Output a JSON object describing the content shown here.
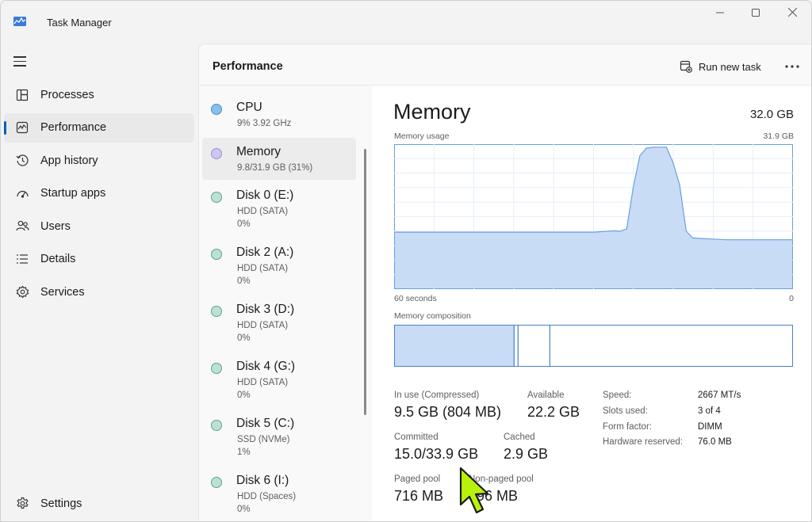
{
  "window": {
    "title": "Task Manager"
  },
  "icons": {
    "app": "task-manager-icon",
    "minimize": "minimize-icon",
    "maximize": "maximize-icon",
    "close": "close-icon",
    "menu": "hamburger-menu-icon",
    "run_task": "run-new-task-icon",
    "more": "more-options-icon"
  },
  "nav": {
    "items": [
      {
        "label": "Processes",
        "icon": "processes-icon",
        "active": false
      },
      {
        "label": "Performance",
        "icon": "performance-icon",
        "active": true
      },
      {
        "label": "App history",
        "icon": "app-history-icon",
        "active": false
      },
      {
        "label": "Startup apps",
        "icon": "startup-apps-icon",
        "active": false
      },
      {
        "label": "Users",
        "icon": "users-icon",
        "active": false
      },
      {
        "label": "Details",
        "icon": "details-icon",
        "active": false
      },
      {
        "label": "Services",
        "icon": "services-icon",
        "active": false
      }
    ],
    "settings": "Settings"
  },
  "header": {
    "title": "Performance",
    "run_task": "Run new task"
  },
  "devices": [
    {
      "name": "CPU",
      "line1": "9%  3.92 GHz",
      "line2": ""
    },
    {
      "name": "Memory",
      "line1": "9.8/31.9 GB (31%)",
      "line2": ""
    },
    {
      "name": "Disk 0 (E:)",
      "line1": "HDD (SATA)",
      "line2": "0%"
    },
    {
      "name": "Disk 2 (A:)",
      "line1": "HDD (SATA)",
      "line2": "0%"
    },
    {
      "name": "Disk 3 (D:)",
      "line1": "HDD (SATA)",
      "line2": "0%"
    },
    {
      "name": "Disk 4 (G:)",
      "line1": "HDD (SATA)",
      "line2": "0%"
    },
    {
      "name": "Disk 5 (C:)",
      "line1": "SSD (NVMe)",
      "line2": "1%"
    },
    {
      "name": "Disk 6 (I:)",
      "line1": "HDD (Spaces)",
      "line2": "0%"
    }
  ],
  "colors": {
    "accent": "#005fb8",
    "graph_line": "#6a9fe0",
    "graph_fill": "#c9dcf6",
    "cursor": "#b8f20c"
  },
  "memory": {
    "title": "Memory",
    "total": "32.0 GB",
    "usage_label": "Memory usage",
    "usage_max": "31.9 GB",
    "time_left": "60 seconds",
    "time_right": "0",
    "composition_label": "Memory composition",
    "stats": {
      "in_use_label": "In use (Compressed)",
      "in_use_value": "9.5 GB (804 MB)",
      "available_label": "Available",
      "available_value": "22.2 GB",
      "committed_label": "Committed",
      "committed_value": "15.0/33.9 GB",
      "cached_label": "Cached",
      "cached_value": "2.9 GB",
      "paged_label": "Paged pool",
      "paged_value": "716 MB",
      "nonpaged_label": "Non-paged pool",
      "nonpaged_value": "596 MB"
    },
    "specs": [
      {
        "label": "Speed:",
        "value": "2667 MT/s"
      },
      {
        "label": "Slots used:",
        "value": "3 of 4"
      },
      {
        "label": "Form factor:",
        "value": "DIMM"
      },
      {
        "label": "Hardware reserved:",
        "value": "76.0 MB"
      }
    ]
  },
  "chart_data": {
    "type": "area",
    "title": "Memory usage",
    "xlabel": "",
    "ylabel": "",
    "x_range_label": [
      "60 seconds",
      "0"
    ],
    "ylim": [
      0,
      31.9
    ],
    "series": [
      {
        "x": [
          60,
          45,
          30,
          27,
          26,
          25,
          24,
          23,
          22,
          21,
          20,
          19,
          18,
          17,
          16,
          15,
          10,
          0
        ],
        "y": [
          12.5,
          12.5,
          12.5,
          12.8,
          12.7,
          13.2,
          22.5,
          29.5,
          31.2,
          31.4,
          31.4,
          31.4,
          28,
          23,
          12.7,
          11.2,
          10.8,
          10.8
        ]
      }
    ],
    "composition": {
      "in_use_fraction": 0.3,
      "modified_fraction": 0.01,
      "standby_fraction": 0.08,
      "free_fraction": 0.61
    }
  }
}
